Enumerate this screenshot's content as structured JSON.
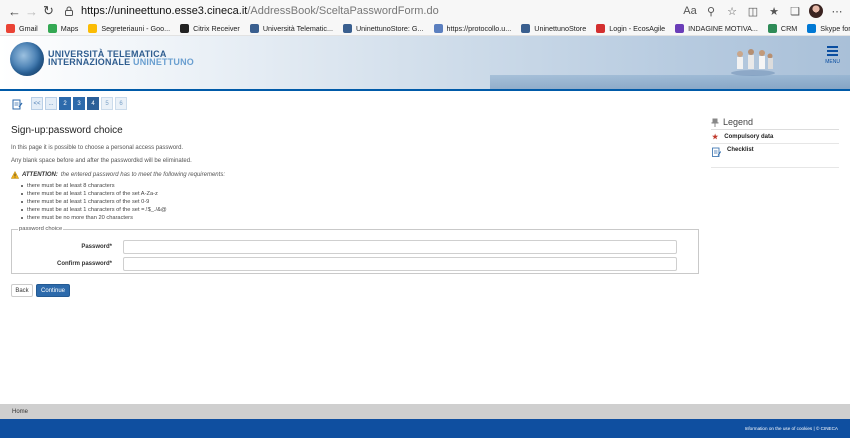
{
  "browser": {
    "url_host": "https://unineettuno.esse3.cineca.it",
    "url_path": "/AddressBook/SceltaPasswordForm.do",
    "bookmarks": [
      {
        "label": "Gmail",
        "color": "#ea4335"
      },
      {
        "label": "Maps",
        "color": "#34a853"
      },
      {
        "label": "Segreteriauni - Goo...",
        "color": "#fbbc04"
      },
      {
        "label": "Citrix Receiver",
        "color": "#222222"
      },
      {
        "label": "Università Telematic...",
        "color": "#3a5f8f"
      },
      {
        "label": "UninettunoStore: G...",
        "color": "#3a5f8f"
      },
      {
        "label": "https://protocollo.u...",
        "color": "#5b7fbf"
      },
      {
        "label": "UninettunoStore",
        "color": "#3a5f8f"
      },
      {
        "label": "Login - EcosAgile",
        "color": "#d32f2f"
      },
      {
        "label": "INDAGINE MOTIVA...",
        "color": "#6a3db8"
      },
      {
        "label": "CRM",
        "color": "#2e8b57"
      },
      {
        "label": "Skype for Business",
        "color": "#0078d4"
      }
    ]
  },
  "header": {
    "logo_line1": "UNIVERSITÀ TELEMATICA",
    "logo_line2a": "INTERNAZIONALE",
    "logo_line2b": "UNINETTUNO",
    "menu_label": "MENU"
  },
  "steps": {
    "prev": "<<",
    "ellipsis": "...",
    "items": [
      "2",
      "3",
      "4",
      "5",
      "6"
    ],
    "current": "4"
  },
  "page": {
    "title": "Sign-up:password choice",
    "intro": "In this page it is possible to choose a personal access password.",
    "blank_note": "Any blank space before and after the passwordkd will be eliminated.",
    "attention_label": "ATTENTION:",
    "attention_text": "the entered password has to meet the following requirements:",
    "requirements": [
      "there must be at least 8 characters",
      "there must be at least 1 characters of the set A-Za-z",
      "there must be at least 1 characters of the set 0-9",
      "there must be at least 1 characters of the set =.!$_./&@",
      "there must be no more than 20 characters"
    ]
  },
  "form": {
    "legend": "password choice",
    "password_label": "Password*",
    "password_value": "",
    "confirm_label": "Confirm password*",
    "confirm_value": "",
    "back_label": "Back",
    "continue_label": "Continue"
  },
  "legend": {
    "title": "Legend",
    "items": [
      "Compulsory data",
      "Checklist"
    ]
  },
  "footer": {
    "home": "Home",
    "info": "Information on the use of cookies | © CINECA"
  },
  "colors": {
    "primary": "#2d6aab",
    "footer_blue": "#0f4fa0",
    "footer_gray": "#cfcfcf"
  }
}
